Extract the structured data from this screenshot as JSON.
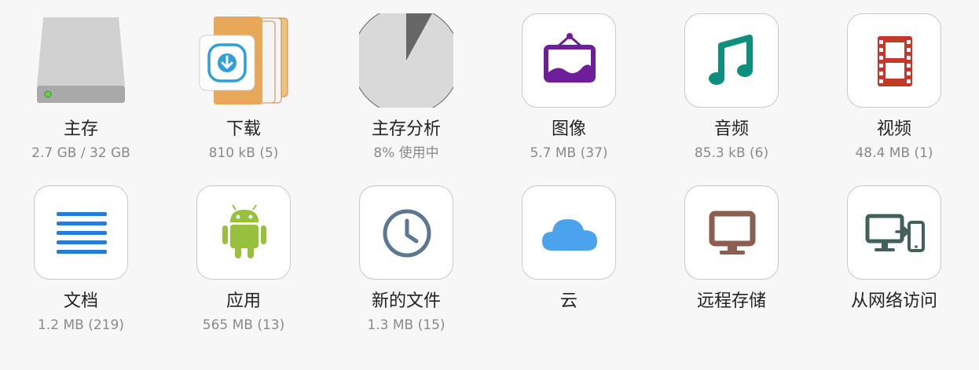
{
  "tiles": [
    {
      "label": "主存",
      "sub": "2.7 GB / 32 GB",
      "icon": "hard-drive-icon"
    },
    {
      "label": "下载",
      "sub": "810 kB (5)",
      "icon": "download-folder-icon"
    },
    {
      "label": "主存分析",
      "sub": "8% 使用中",
      "icon": "storage-pie-chart-icon",
      "used_percent": 8
    },
    {
      "label": "图像",
      "sub": "5.7 MB (37)",
      "icon": "picture-frame-icon"
    },
    {
      "label": "音频",
      "sub": "85.3 kB (6)",
      "icon": "music-note-icon"
    },
    {
      "label": "视频",
      "sub": "48.4 MB (1)",
      "icon": "film-strip-icon"
    },
    {
      "label": "文档",
      "sub": "1.2 MB (219)",
      "icon": "document-lines-icon"
    },
    {
      "label": "应用",
      "sub": "565 MB (13)",
      "icon": "android-icon"
    },
    {
      "label": "新的文件",
      "sub": "1.3 MB (15)",
      "icon": "clock-icon"
    },
    {
      "label": "云",
      "sub": "",
      "icon": "cloud-icon"
    },
    {
      "label": "远程存储",
      "sub": "",
      "icon": "monitor-icon"
    },
    {
      "label": "从网络访问",
      "sub": "",
      "icon": "network-access-icon"
    }
  ],
  "colors": {
    "background": "#f7f7f7",
    "picture": "#6e1e9a",
    "music": "#0d8f7e",
    "film": "#c0392b",
    "document": "#2a7bd4",
    "android": "#97c03d",
    "clock": "#5b7890",
    "cloud": "#4aa3ec",
    "monitor": "#8b5e4f",
    "network": "#42605a",
    "folder": "#e8a85a",
    "pie_used": "#666666",
    "pie_free": "#d9d9d9"
  }
}
